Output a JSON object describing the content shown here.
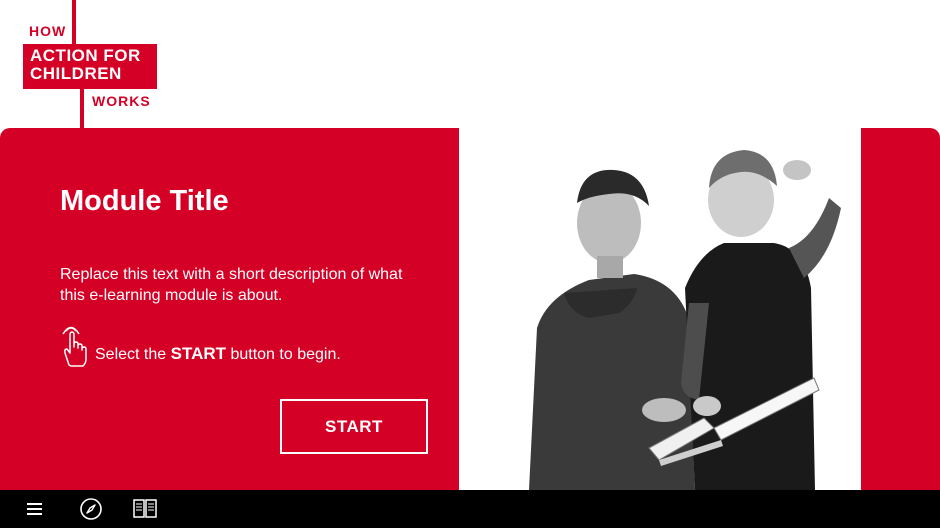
{
  "logo": {
    "line_how": "HOW",
    "line_1": "ACTION FOR",
    "line_2": "CHILDREN",
    "line_works": "WORKS"
  },
  "module": {
    "title": "Module Title",
    "description": "Replace this text with a short description of what this e-learning module is about.",
    "instruction_prefix": "Select the",
    "instruction_keyword": "START",
    "instruction_suffix": "button to begin."
  },
  "start_button": {
    "label": "START"
  },
  "toolbar": {
    "icons": [
      "menu-icon",
      "compass-icon",
      "book-icon"
    ]
  },
  "colors": {
    "brand_red": "#d50026",
    "toolbar_bg": "#000000",
    "text_on_red": "#ffffff"
  }
}
